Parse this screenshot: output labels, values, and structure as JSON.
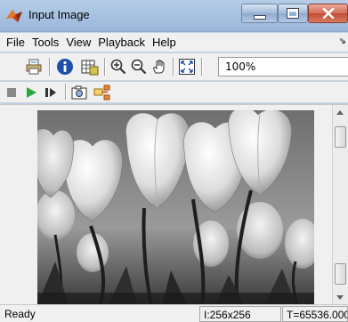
{
  "window": {
    "title": "Input Image"
  },
  "menu": [
    "File",
    "Tools",
    "View",
    "Playback",
    "Help"
  ],
  "toolbar": {
    "icons": [
      "print-icon",
      "info-icon",
      "pixel-region-icon",
      "zoom-in-icon",
      "zoom-out-icon",
      "pan-hand-icon",
      "fit-to-window-icon"
    ],
    "zoom": "100%"
  },
  "playback": {
    "icons": [
      "stop-icon",
      "play-icon",
      "step-forward-icon",
      "snapshot-icon",
      "highlight-source-icon"
    ]
  },
  "image": {
    "description": "grayscale tulips",
    "size": "256x256"
  },
  "status": {
    "text": "Ready",
    "size_label": "I:256x256",
    "time_label": "T=65536.000"
  },
  "colors": {
    "play": "#2da83a",
    "close": "#c8513a",
    "titlebar": "#a9c3e2"
  }
}
